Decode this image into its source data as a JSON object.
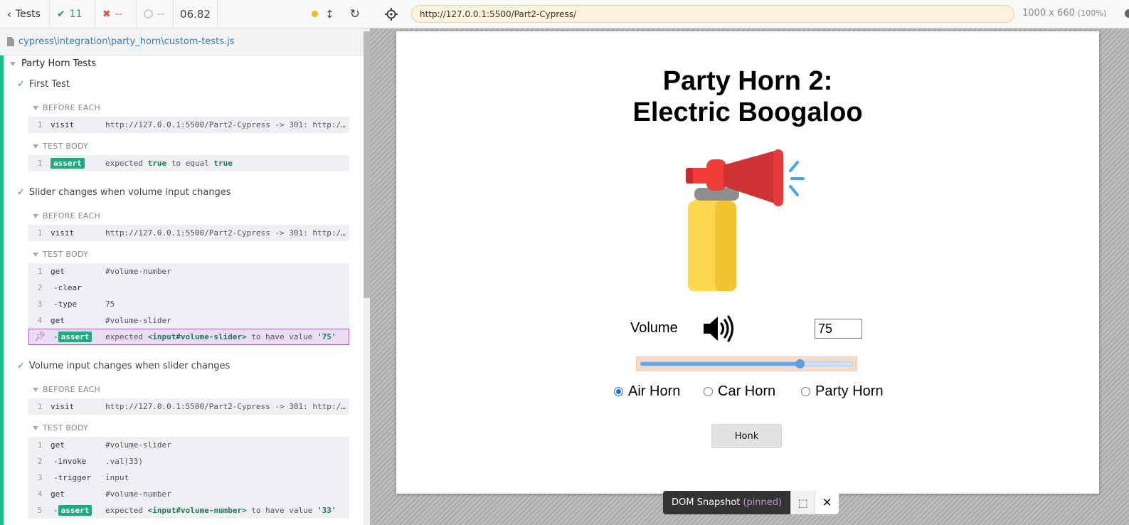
{
  "stats": {
    "tests_label": "Tests",
    "passed": "11",
    "failed": "--",
    "pending": "--",
    "duration": "06.82"
  },
  "spec_file": "cypress\\integration\\party_horn\\custom-tests.js",
  "suite": {
    "title": "Party Horn Tests",
    "tests": [
      {
        "title": "First Test",
        "before_each_label": "BEFORE EACH",
        "before_each": [
          {
            "num": "1",
            "name": "visit",
            "message": "http://127.0.0.1:5500/Part2-Cypress -> 301: http:/..."
          }
        ],
        "body_label": "TEST BODY",
        "body": [
          {
            "num": "1",
            "badge": "assert",
            "expected": "expected",
            "a": "true",
            "mid": "to equal",
            "b": "true"
          }
        ]
      },
      {
        "title": "Slider changes when volume input changes",
        "before_each_label": "BEFORE EACH",
        "before_each": [
          {
            "num": "1",
            "name": "visit",
            "message": "http://127.0.0.1:5500/Part2-Cypress -> 301: http:/..."
          }
        ],
        "body_label": "TEST BODY",
        "body": [
          {
            "num": "1",
            "name": "get",
            "message": "#volume-number"
          },
          {
            "num": "2",
            "name": "-clear",
            "message": ""
          },
          {
            "num": "3",
            "name": "-type",
            "message": "75"
          },
          {
            "num": "4",
            "name": "get",
            "message": "#volume-slider"
          },
          {
            "num": "",
            "badge": "assert",
            "expected": "expected",
            "a": "<input#volume-slider>",
            "mid": "to have value",
            "b": "'75'"
          }
        ]
      },
      {
        "title": "Volume input changes when slider changes",
        "before_each_label": "BEFORE EACH",
        "before_each": [
          {
            "num": "1",
            "name": "visit",
            "message": "http://127.0.0.1:5500/Part2-Cypress -> 301: http:/..."
          }
        ],
        "body_label": "TEST BODY",
        "body": [
          {
            "num": "1",
            "name": "get",
            "message": "#volume-slider"
          },
          {
            "num": "2",
            "name": "-invoke",
            "message": ".val(33)"
          },
          {
            "num": "3",
            "name": "-trigger",
            "message": "input"
          },
          {
            "num": "4",
            "name": "get",
            "message": "#volume-number"
          },
          {
            "num": "5",
            "badge": "assert",
            "expected": "expected",
            "a": "<input#volume-number>",
            "mid": "to have value",
            "b": "'33'"
          }
        ]
      }
    ]
  },
  "aut": {
    "url": "http://127.0.0.1:5500/Part2-Cypress/",
    "viewport": "1000 x 660",
    "zoom": "(100%)",
    "page": {
      "title_line1": "Party Horn 2:",
      "title_line2": "Electric Boogaloo",
      "volume_label": "Volume",
      "volume_value": "75",
      "slider_value": 0.75,
      "radios": [
        {
          "label": "Air Horn",
          "checked": true
        },
        {
          "label": "Car Horn",
          "checked": false
        },
        {
          "label": "Party Horn",
          "checked": false
        }
      ],
      "honk_label": "Honk"
    },
    "snapshot": {
      "label": "DOM Snapshot",
      "state": "(pinned)"
    }
  },
  "colors": {
    "pass": "#1fa35a",
    "fail": "#d9534f",
    "accent_green": "#16bf88",
    "url_bg": "#fdf2dc",
    "pinned": "#a15fc1"
  }
}
